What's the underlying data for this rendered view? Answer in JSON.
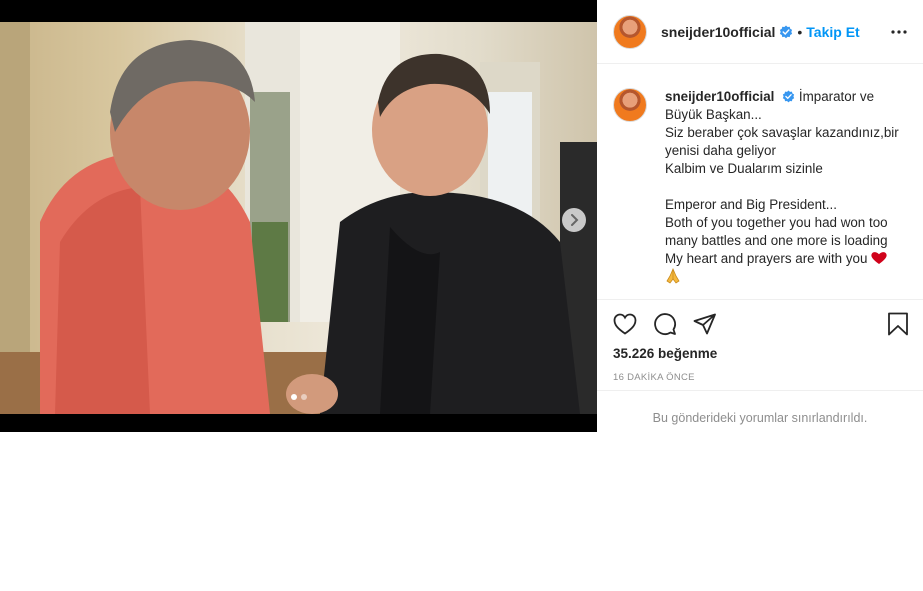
{
  "post": {
    "username": "sneijder10official",
    "follow_label": "Takip Et",
    "separator": "•",
    "caption_lines": [
      "İmparator ve",
      "Büyük Başkan...",
      "Siz beraber çok savaşlar kazandınız,bir",
      "yenisi daha geliyor",
      "Kalbim ve Dualarım sizinle",
      "",
      "Emperor and Big President...",
      "Both of you together you had won too",
      "many battles and one more is loading",
      "My heart and prayers are with you"
    ],
    "likes": "35.226 beğenme",
    "time": "16 DAKİKA ÖNCE",
    "comments_restricted": "Bu gönderideki yorumlar sınırlandırıldı.",
    "carousel": {
      "count": 2,
      "active_index": 0
    },
    "colors": {
      "link": "#0095f6",
      "verified": "#3897f0",
      "heart": "#d0021b"
    },
    "icons": [
      "verified-badge-icon",
      "more-options-icon",
      "like-heart-icon",
      "comment-icon",
      "share-icon",
      "save-bookmark-icon",
      "next-chevron-icon",
      "red-heart-emoji",
      "praying-hands-emoji"
    ]
  }
}
